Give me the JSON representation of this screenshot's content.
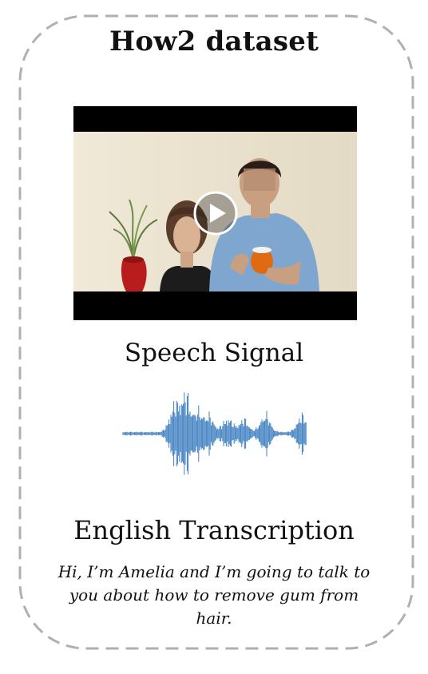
{
  "title": "How2 dataset",
  "video": {
    "thumbnail": "woman-with-mannequin-head-icon",
    "play_icon": "play-icon"
  },
  "speech": {
    "label": "Speech Signal",
    "waveform_icon": "audio-waveform-icon",
    "waveform_color": "#3f7fc0"
  },
  "transcription": {
    "label": "English Transcription",
    "text": "Hi, I’m Amelia and I’m going to talk to you about how to remove gum from hair."
  },
  "colors": {
    "border": "#b0b0b0",
    "video_bg": "#000000",
    "wall": "#eee6d2",
    "shirt": "#7fa6cf",
    "vase": "#b81c1c"
  }
}
